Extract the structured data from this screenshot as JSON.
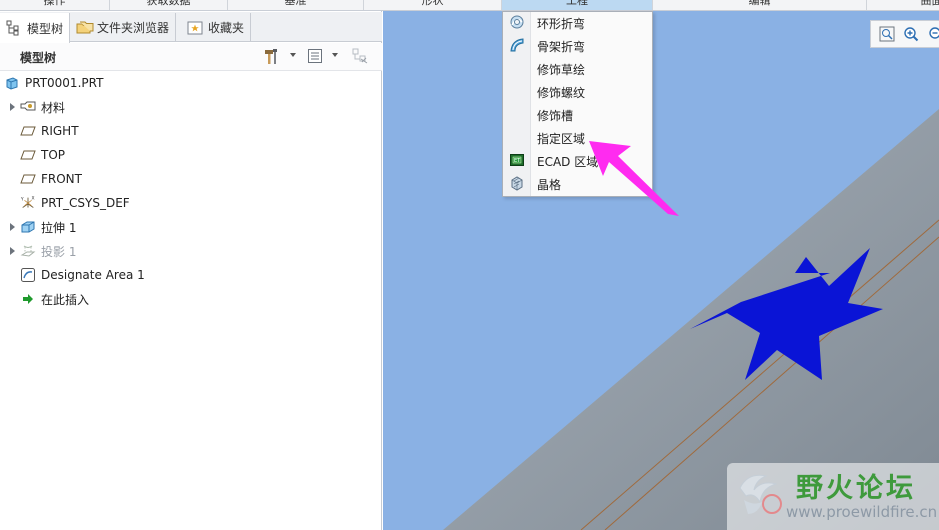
{
  "ribbon": {
    "tabs": [
      {
        "label": "操作",
        "active": false
      },
      {
        "label": "获取数据",
        "active": false
      },
      {
        "label": "基准",
        "active": false
      },
      {
        "label": "形状",
        "active": false
      },
      {
        "label": "工程",
        "active": true
      },
      {
        "label": "编辑",
        "active": false
      },
      {
        "label": "曲面",
        "active": false
      }
    ]
  },
  "panel": {
    "tabs": [
      {
        "label": "模型树",
        "icon": "model-tree-icon",
        "active": true
      },
      {
        "label": "文件夹浏览器",
        "icon": "folder-icon",
        "active": false
      },
      {
        "label": "收藏夹",
        "icon": "favorites-icon",
        "active": false
      }
    ],
    "toolbar_title": "模型树"
  },
  "tree": {
    "items": [
      {
        "label": "PRT0001.PRT",
        "icon": "part-icon",
        "expandable": false,
        "dim": false
      },
      {
        "label": "材料",
        "icon": "material-icon",
        "expandable": true,
        "dim": false
      },
      {
        "label": "RIGHT",
        "icon": "datum-plane-icon",
        "expandable": false,
        "dim": false
      },
      {
        "label": "TOP",
        "icon": "datum-plane-icon",
        "expandable": false,
        "dim": false
      },
      {
        "label": "FRONT",
        "icon": "datum-plane-icon",
        "expandable": false,
        "dim": false
      },
      {
        "label": "PRT_CSYS_DEF",
        "icon": "coordinate-system-icon",
        "expandable": false,
        "dim": false
      },
      {
        "label": "拉伸 1",
        "icon": "extrude-icon",
        "expandable": true,
        "dim": false
      },
      {
        "label": "投影 1",
        "icon": "projection-icon",
        "expandable": true,
        "dim": true
      },
      {
        "label": "Designate Area 1",
        "icon": "designate-area-icon",
        "expandable": false,
        "dim": false
      },
      {
        "label": "在此插入",
        "icon": "insert-here-arrow-icon",
        "expandable": false,
        "dim": false
      }
    ]
  },
  "menu": {
    "items": [
      {
        "label": "环形折弯",
        "icon": "toroidal-bend-icon"
      },
      {
        "label": "骨架折弯",
        "icon": "spinal-bend-icon"
      },
      {
        "label": "修饰草绘",
        "icon": ""
      },
      {
        "label": "修饰螺纹",
        "icon": ""
      },
      {
        "label": "修饰槽",
        "icon": ""
      },
      {
        "label": "指定区域",
        "icon": ""
      },
      {
        "label": "ECAD 区域",
        "icon": "ecad-area-icon"
      },
      {
        "label": "晶格",
        "icon": "lattice-icon"
      }
    ]
  },
  "colors": {
    "viewport_bg": "#8ab1e4",
    "part_surface": "#97a2ad",
    "star_fill": "#0a14d6",
    "annotation_arrow": "#ff2bf0",
    "watermark_green": "#3e9a3c"
  },
  "watermark": {
    "title": "野火论坛",
    "url": "www.proewildfire.cn"
  }
}
